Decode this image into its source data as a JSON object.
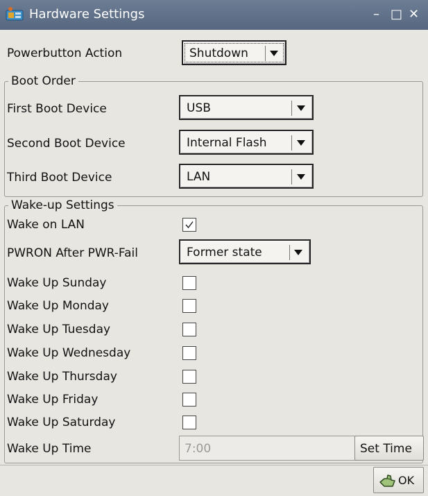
{
  "window": {
    "title": "Hardware Settings",
    "minimize": "–",
    "maximize": "□",
    "close": "✕"
  },
  "power": {
    "label": "Powerbutton Action",
    "value": "Shutdown"
  },
  "boot_order": {
    "title": "Boot Order",
    "rows": [
      {
        "label": "First Boot Device",
        "value": "USB"
      },
      {
        "label": "Second Boot Device",
        "value": "Internal Flash"
      },
      {
        "label": "Third Boot Device",
        "value": "LAN"
      }
    ]
  },
  "wake": {
    "title": "Wake-up Settings",
    "wake_on_lan": {
      "label": "Wake on LAN",
      "checked": true
    },
    "pwron": {
      "label": "PWRON After PWR-Fail",
      "value": "Former state"
    },
    "days": [
      {
        "label": "Wake Up Sunday",
        "checked": false
      },
      {
        "label": "Wake Up Monday",
        "checked": false
      },
      {
        "label": "Wake Up Tuesday",
        "checked": false
      },
      {
        "label": "Wake Up Wednesday",
        "checked": false
      },
      {
        "label": "Wake Up Thursday",
        "checked": false
      },
      {
        "label": "Wake Up Friday",
        "checked": false
      },
      {
        "label": "Wake Up Saturday",
        "checked": false
      }
    ],
    "time": {
      "label": "Wake Up Time",
      "value": "7:00",
      "button": "Set Time"
    }
  },
  "footer": {
    "ok": "OK"
  },
  "colors": {
    "titlebar": "#5f7089",
    "background": "#e8e6e1"
  }
}
